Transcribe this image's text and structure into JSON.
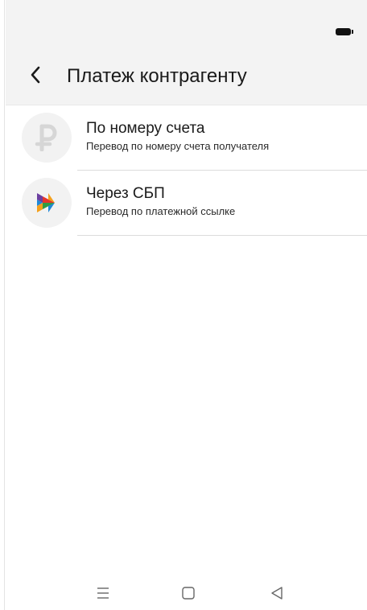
{
  "header": {
    "title": "Платеж контрагенту",
    "back_icon": "chevron-left-icon"
  },
  "status_bar": {
    "battery_icon": "battery-icon"
  },
  "list": {
    "items": [
      {
        "title": "По номеру счета",
        "subtitle": "Перевод по номеру счета получателя",
        "icon": "ruble-icon",
        "icon_color": "#d6d6d6"
      },
      {
        "title": "Через СБП",
        "subtitle": "Перевод по платежной ссылке",
        "icon": "sbp-logo-icon",
        "icon_colors": [
          "#e7352b",
          "#f4a01c",
          "#2f9c44",
          "#6b3fa0",
          "#1e88d8"
        ]
      }
    ]
  },
  "nav_bar": {
    "menu_icon": "menu-icon",
    "home_icon": "home-icon",
    "back_icon": "triangle-back-icon"
  },
  "colors": {
    "header_background": "#f3f3f3",
    "background": "#ffffff",
    "text_primary": "#1a1a1a",
    "divider": "#dcdcdc"
  }
}
